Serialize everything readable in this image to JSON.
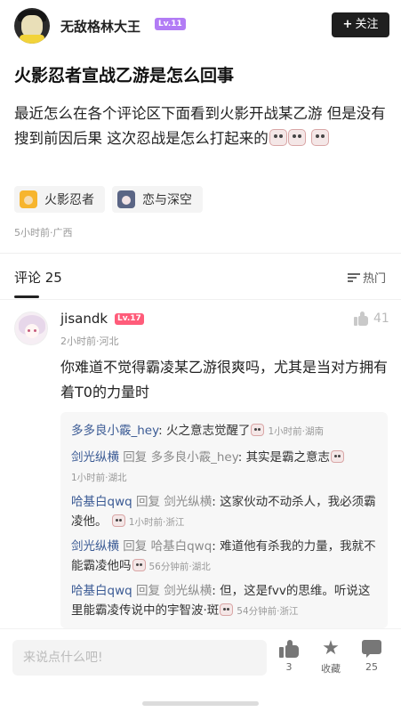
{
  "author": {
    "name": "无敌格林大王",
    "level": "Lv.11",
    "follow_label": "关注",
    "follow_plus": "+"
  },
  "post": {
    "title": "火影忍者宣战乙游是怎么回事",
    "body": "最近怎么在各个评论区下面看到火影开战某乙游 但是没有搜到前因后果 这次忍战是怎么打起来的",
    "tags": [
      {
        "label": "火影忍者",
        "icon": "naruto-icon"
      },
      {
        "label": "恋与深空",
        "icon": "love-and-deepspace-icon"
      }
    ],
    "meta": "5小时前·广西"
  },
  "comments_header": {
    "label": "评论 25",
    "sort_label": "热门"
  },
  "comment": {
    "user": "jisandk",
    "level": "Lv.17",
    "meta": "2小时前·河北",
    "likes": "41",
    "text": "你难道不觉得霸凌某乙游很爽吗，尤其是当对方拥有着T0的力量时"
  },
  "replies": [
    {
      "user": "多多良小霰_hey",
      "reply_word": "",
      "target": "",
      "text": "火之意志觉醒了",
      "time": "1小时前·湖南"
    },
    {
      "user": "剑光纵横",
      "reply_word": "回复",
      "target": "多多良小霰_hey",
      "text": "其实是霸之意志",
      "time": "1小时前·湖北"
    },
    {
      "user": "哈基白qwq",
      "reply_word": "回复",
      "target": "剑光纵横",
      "text": "这家伙动不动杀人，我必须霸凌他。",
      "time": "1小时前·浙江"
    },
    {
      "user": "剑光纵横",
      "reply_word": "回复",
      "target": "哈基白qwq",
      "text": "难道他有杀我的力量，我就不能霸凌他吗",
      "time": "56分钟前·湖北"
    },
    {
      "user": "哈基白qwq",
      "reply_word": "回复",
      "target": "剑光纵横",
      "text": "但，这是fvv的思维。听说这里能霸凌传说中的宇智波·斑",
      "time": "54分钟前·浙江"
    }
  ],
  "bottom_bar": {
    "input_placeholder": "来说点什么吧!",
    "like_count": "3",
    "fav_label": "收藏",
    "comment_count": "25"
  },
  "colors": {
    "level_badge_author": "#b27cf5",
    "level_badge_commenter": "#ff5c7a",
    "reply_name": "#3a5a94",
    "follow_button": "#1f1f1f"
  }
}
